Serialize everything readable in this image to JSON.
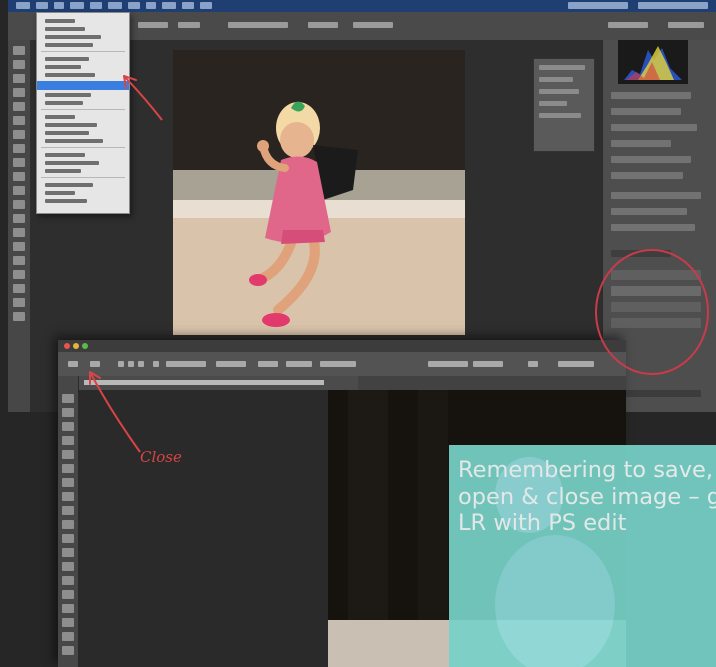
{
  "annotation": {
    "close_label": "Close"
  },
  "caption": {
    "text": "Remembering to save, leave PS open & close image – goes back to LR with PS edit"
  },
  "colors": {
    "annotation_red": "#d94444",
    "caption_bg": "#78d2c8",
    "caption_text": "#f4fbfa",
    "menu_highlight": "#3a7ee0",
    "photoshop_chrome": "#3a3a3a"
  },
  "icons": {
    "annotation_arrow": "red-arrow-icon",
    "close_highlight": "red-circle-icon"
  }
}
